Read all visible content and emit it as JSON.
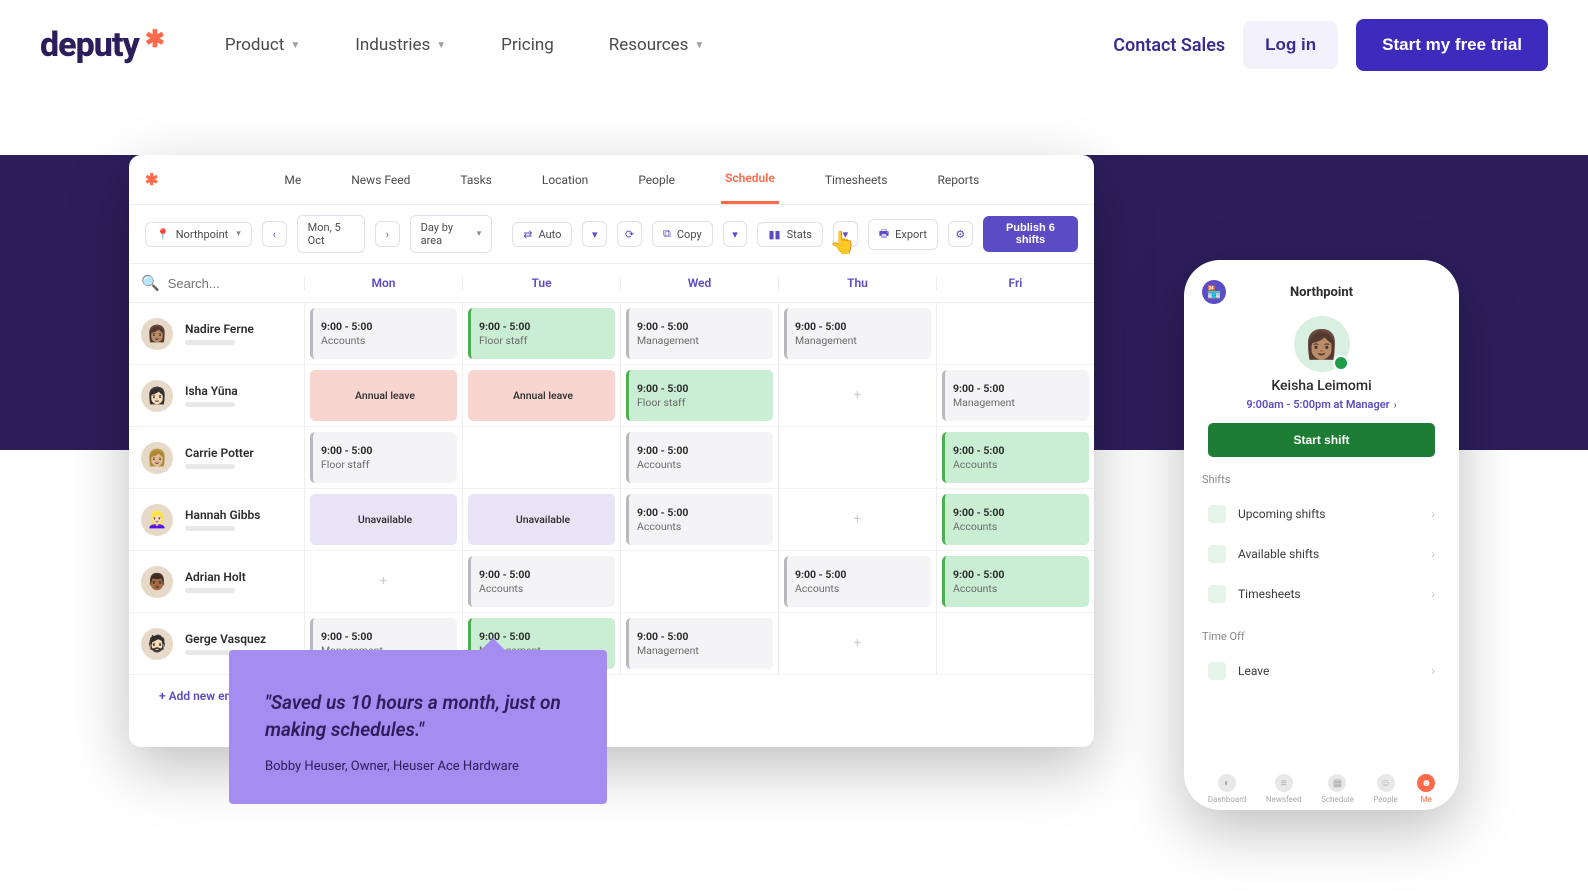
{
  "nav": {
    "brand": "deputy",
    "links": [
      "Product",
      "Industries",
      "Pricing",
      "Resources"
    ],
    "contact": "Contact Sales",
    "login": "Log in",
    "trial": "Start my free trial"
  },
  "app": {
    "tabs": [
      "Me",
      "News Feed",
      "Tasks",
      "Location",
      "People",
      "Schedule",
      "Timesheets",
      "Reports"
    ],
    "active_tab": "Schedule",
    "location": "Northpoint",
    "date": "Mon, 5 Oct",
    "view": "Day by area",
    "btn_auto": "Auto",
    "btn_copy": "Copy",
    "btn_stats": "Stats",
    "btn_export": "Export",
    "btn_publish": "Publish 6 shifts",
    "search_placeholder": "Search...",
    "days": [
      "Mon",
      "Tue",
      "Wed",
      "Thu",
      "Fri"
    ],
    "people": [
      {
        "name": "Nadire Ferne",
        "emoji": "👩🏽",
        "cells": [
          {
            "type": "grey",
            "time": "9:00 - 5:00",
            "role": "Accounts"
          },
          {
            "type": "green",
            "time": "9:00 - 5:00",
            "role": "Floor staff"
          },
          {
            "type": "grey",
            "time": "9:00 - 5:00",
            "role": "Management"
          },
          {
            "type": "grey",
            "time": "9:00 - 5:00",
            "role": "Management"
          },
          {
            "type": "empty"
          }
        ]
      },
      {
        "name": "Isha Yūna",
        "emoji": "👩🏻",
        "cells": [
          {
            "type": "red",
            "label": "Annual leave"
          },
          {
            "type": "red",
            "label": "Annual leave"
          },
          {
            "type": "green",
            "time": "9:00 - 5:00",
            "role": "Floor staff"
          },
          {
            "type": "plus"
          },
          {
            "type": "grey",
            "time": "9:00 - 5:00",
            "role": "Management"
          }
        ]
      },
      {
        "name": "Carrie Potter",
        "emoji": "👩🏼",
        "cells": [
          {
            "type": "grey",
            "time": "9:00 - 5:00",
            "role": "Floor staff"
          },
          {
            "type": "empty"
          },
          {
            "type": "grey",
            "time": "9:00 - 5:00",
            "role": "Accounts"
          },
          {
            "type": "empty"
          },
          {
            "type": "green",
            "time": "9:00 - 5:00",
            "role": "Accounts"
          }
        ]
      },
      {
        "name": "Hannah Gibbs",
        "emoji": "👱🏻‍♀️",
        "cells": [
          {
            "type": "purple",
            "label": "Unavailable"
          },
          {
            "type": "purple",
            "label": "Unavailable"
          },
          {
            "type": "grey",
            "time": "9:00 - 5:00",
            "role": "Accounts"
          },
          {
            "type": "plus"
          },
          {
            "type": "green",
            "time": "9:00 - 5:00",
            "role": "Accounts"
          }
        ]
      },
      {
        "name": "Adrian Holt",
        "emoji": "👨🏾",
        "cells": [
          {
            "type": "plus"
          },
          {
            "type": "grey",
            "time": "9:00 - 5:00",
            "role": "Accounts"
          },
          {
            "type": "empty"
          },
          {
            "type": "grey",
            "time": "9:00 - 5:00",
            "role": "Accounts"
          },
          {
            "type": "green",
            "time": "9:00 - 5:00",
            "role": "Accounts"
          }
        ]
      },
      {
        "name": "Gerge Vasquez",
        "emoji": "🧔🏻",
        "cells": [
          {
            "type": "grey",
            "time": "9:00 - 5:00",
            "role": "Management"
          },
          {
            "type": "green",
            "time": "9:00 - 5:00",
            "role": "Management"
          },
          {
            "type": "grey",
            "time": "9:00 - 5:00",
            "role": "Management"
          },
          {
            "type": "plus"
          },
          {
            "type": "empty"
          }
        ]
      }
    ],
    "add_employee": "+ Add new employee"
  },
  "quote": {
    "text": "\"Saved us 10 hours a month, just on making schedules.\"",
    "author": "Bobby Heuser, Owner, Heuser Ace Hardware"
  },
  "phone": {
    "location": "Northpoint",
    "user_name": "Keisha Leimomi",
    "user_shift": "9:00am - 5:00pm at Manager",
    "start": "Start shift",
    "section_shifts": "Shifts",
    "items_shifts": [
      "Upcoming shifts",
      "Available shifts",
      "Timesheets"
    ],
    "section_timeoff": "Time Off",
    "items_timeoff": [
      "Leave"
    ],
    "tabs": [
      "Dashboard",
      "Newsfeed",
      "Schedule",
      "People",
      "Me"
    ]
  }
}
